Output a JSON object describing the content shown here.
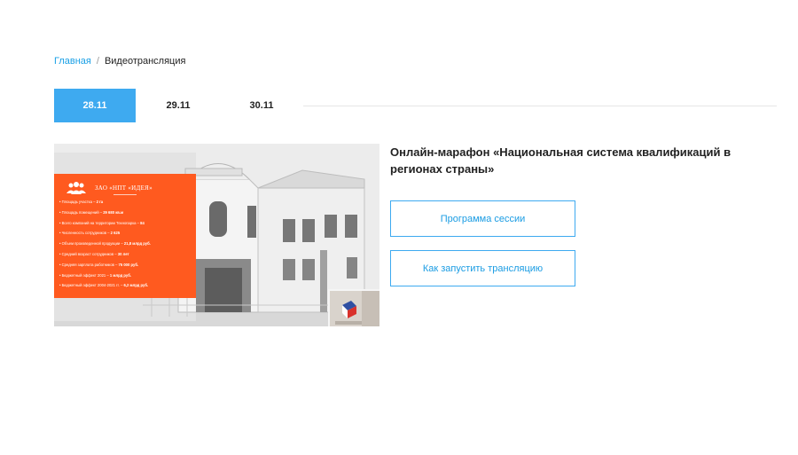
{
  "breadcrumb": {
    "home_label": "Главная",
    "separator": "/",
    "current_label": "Видеотрансляция"
  },
  "tabs": [
    {
      "label": "28.11",
      "active": true
    },
    {
      "label": "29.11",
      "active": false
    },
    {
      "label": "30.11",
      "active": false
    }
  ],
  "session": {
    "title": "Онлайн-марафон «Национальная система квалификаций в регионах страны»",
    "program_button": "Программа сессии",
    "howto_button": "Как запустить трансляцию"
  },
  "video": {
    "company_title": "ЗАО «НПТ «ИДЕЯ»",
    "facts": [
      {
        "label": "Площадь участка – ",
        "value": "2 га"
      },
      {
        "label": "Площадь помещений – ",
        "value": "29 680 кв.м"
      },
      {
        "label": "Всего компаний на территории Технопарка – ",
        "value": "84"
      },
      {
        "label": "Численность сотрудников – ",
        "value": "2 625"
      },
      {
        "label": "Объем произведенной продукции – ",
        "value": "21,8 млрд руб."
      },
      {
        "label": "Средний возраст сотрудников – ",
        "value": "30 лет"
      },
      {
        "label": "Средняя зарплата работников – ",
        "value": "75 000 руб."
      },
      {
        "label": "Бюджетный эффект 2021 – ",
        "value": "1 млрд руб."
      },
      {
        "label": "Бюджетный эффект 2004-2021 гг. – ",
        "value": "6,2 млрд руб."
      }
    ]
  },
  "colors": {
    "accent": "#3eaaf0",
    "link": "#1aa0e6",
    "slide_orange": "#ff5a1f"
  }
}
